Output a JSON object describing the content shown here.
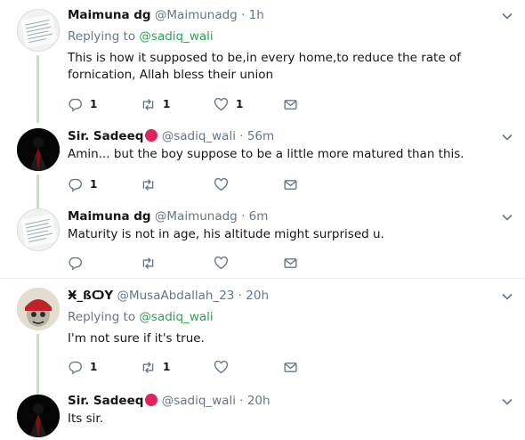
{
  "tweets": [
    {
      "name": "Maimuna dg",
      "handle": "@Maimunadg",
      "dot": "·",
      "time": "1h",
      "replying_prefix": "Replying to ",
      "replying_to": "@sadiq_wali",
      "text": "This is how it supposed to be,in every home,to reduce the rate of fornication, Allah bless their union",
      "reply_count": "1",
      "retweet_count": "1",
      "like_count": "1"
    },
    {
      "name": "Sir. Sadeeq",
      "handle": "@sadiq_wali",
      "dot": "·",
      "time": "56m",
      "text": "Amin... but the boy suppose to be a little more matured than this.",
      "reply_count": "1",
      "retweet_count": "",
      "like_count": ""
    },
    {
      "name": "Maimuna dg",
      "handle": "@Maimunadg",
      "dot": "·",
      "time": "6m",
      "text": "Maturity is not in age, his altitude might surprised u.",
      "reply_count": "",
      "retweet_count": "",
      "like_count": ""
    },
    {
      "name": "Ӿ_ßѺY",
      "handle": "@MusaAbdallah_23",
      "dot": "·",
      "time": "20h",
      "replying_prefix": "Replying to ",
      "replying_to": "@sadiq_wali",
      "text": "I'm not sure if it's true.",
      "reply_count": "1",
      "retweet_count": "1",
      "like_count": ""
    },
    {
      "name": "Sir. Sadeeq",
      "handle": "@sadiq_wali",
      "dot": "·",
      "time": "20h",
      "text": "Its sir."
    }
  ],
  "colors": {
    "accent": "#2aa54f",
    "thread_line": "#c7e2c3",
    "muted": "#657786",
    "badge": "#e0245e"
  }
}
